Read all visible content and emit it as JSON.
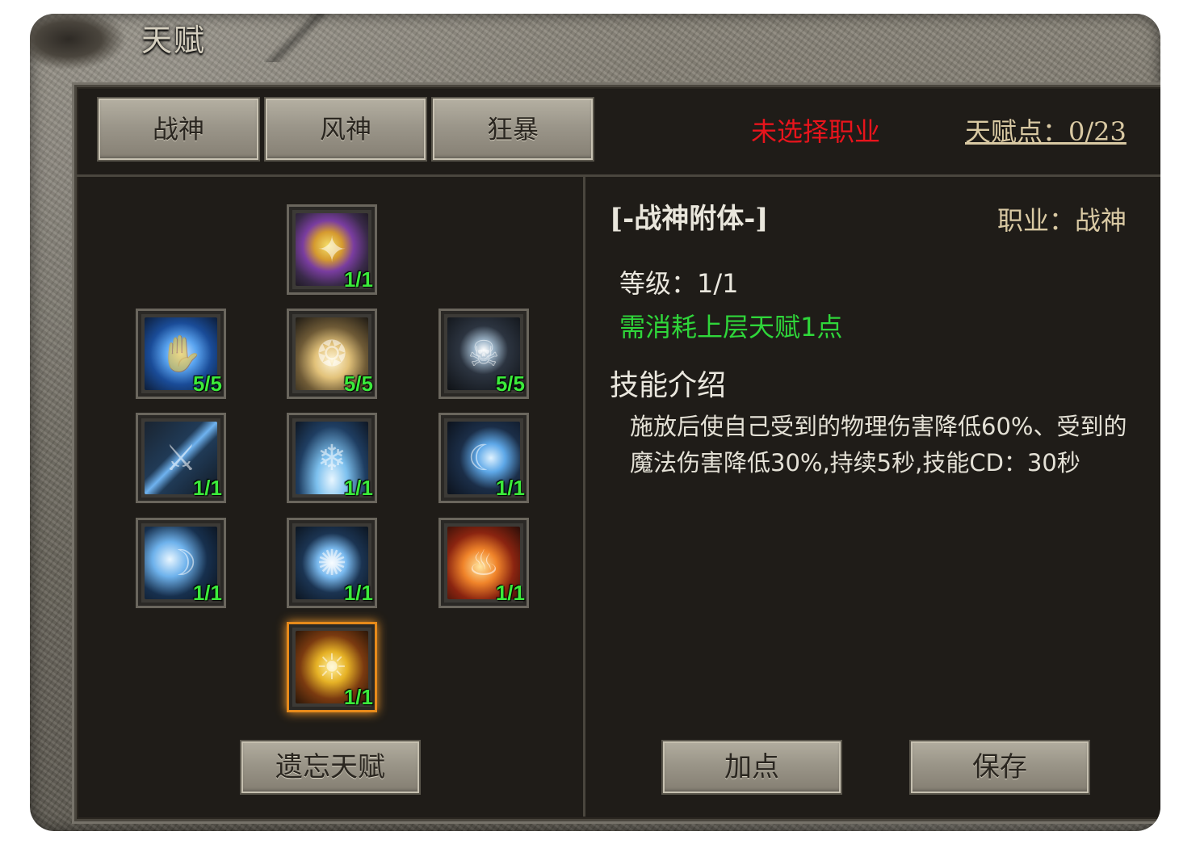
{
  "window": {
    "title": "天赋"
  },
  "tabs": [
    {
      "label": "战神"
    },
    {
      "label": "风神"
    },
    {
      "label": "狂暴"
    }
  ],
  "header": {
    "status": "未选择职业",
    "talent_points": "天赋点：0/23",
    "status_color": "#e8141c"
  },
  "talents": [
    {
      "icon": "golden-orb-icon",
      "level": "1/1",
      "selected": false
    },
    {
      "icon": "blue-hand-icon",
      "level": "5/5",
      "selected": false
    },
    {
      "icon": "golden-shield-icon",
      "level": "5/5",
      "selected": false
    },
    {
      "icon": "dark-spirit-icon",
      "level": "5/5",
      "selected": false
    },
    {
      "icon": "sword-icon",
      "level": "1/1",
      "selected": false
    },
    {
      "icon": "ice-claws-icon",
      "level": "1/1",
      "selected": false
    },
    {
      "icon": "crescent-slash-icon",
      "level": "1/1",
      "selected": false
    },
    {
      "icon": "crescent-moon-icon",
      "level": "1/1",
      "selected": false
    },
    {
      "icon": "whirlwind-figure-icon",
      "level": "1/1",
      "selected": false
    },
    {
      "icon": "flame-icon",
      "level": "1/1",
      "selected": false
    },
    {
      "icon": "lion-crest-icon",
      "level": "1/1",
      "selected": true
    }
  ],
  "detail": {
    "skill_name": "[-战神附体-]",
    "class": "职业：战神",
    "level": "等级：1/1",
    "requirement": "需消耗上层天赋1点",
    "intro_heading": "技能介绍",
    "description": "施放后使自己受到的物理伤害降低60%、受到的魔法伤害降低30%,持续5秒,技能CD：30秒",
    "requirement_color": "#2fd63a"
  },
  "buttons": {
    "forget": "遗忘天赋",
    "add_point": "加点",
    "save": "保存"
  }
}
